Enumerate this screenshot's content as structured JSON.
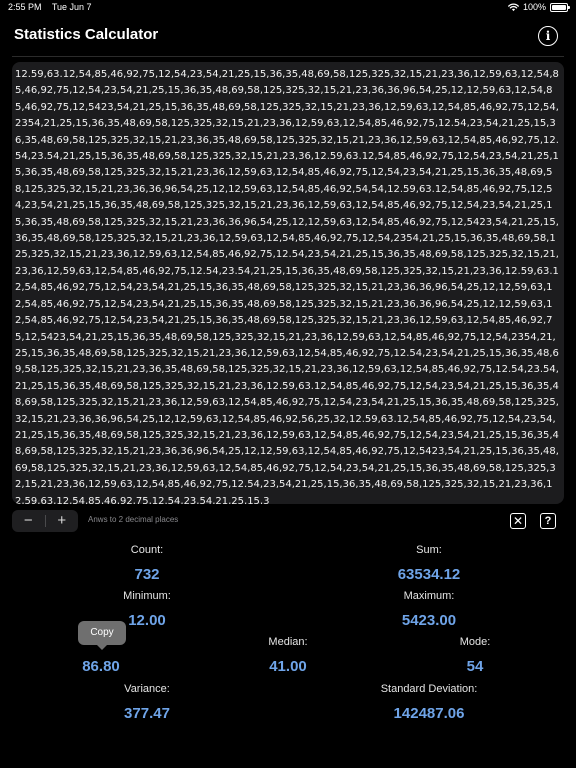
{
  "status_bar": {
    "time": "2:55 PM",
    "date": "Tue Jun 7",
    "battery": "100%",
    "battery_level": 1.0
  },
  "header": {
    "title": "Statistics Calculator",
    "info_icon": "info-circle-icon",
    "info_glyph": "i"
  },
  "input": {
    "text": "12.59,63.12,54,85,46,92,75,12,54,23,54,21,25,15,36,35,48,69,58,125,325,32,15,21,23,36,12,59,63,12,54,85,46,92,75,12,54,23,54,21,25,15,36,35,48,69,58,125,325,32,15,21,23,36,36,96,54,25,12,12,59,63,12,54,85,46,92,75,12,5423,54,21,25,15,36,35,48,69,58,125,325,32,15,21,23,36,12,59,63,12,54,85,46,92,75,12,54,2354,21,25,15,36,35,48,69,58,125,325,32,15,21,23,36,12,59,63,12,54,85,46,92,75,12.54,23,54,21,25,15,36,35,48,69,58,125,325,32,15,21,23,36,35,48,69,58,125,325,32,15,21,23,36,12,59,63,12,54,85,46,92,75,12.54,23.54,21,25,15,36,35,48,69,58,125,325,32,15,21,23,36,12.59,63.12,54,85,46,92,75,12,54,23,54,21,25,15,36,35,48,69,58,125,325,32,15,21,23,36,12,59,63,12,54,85,46,92,75,12,54,23,54,21,25,15,36,35,48,69,58,125,325,32,15,21,23,36,36,96,54,25,12,12,59,63,12,54,85,46,92,54,54,12.59,63.12,54,85,46,92,75,12,54,23,54,21,25,15,36,35,48,69,58,125,325,32,15,21,23,36,12,59,63,12,54,85,46,92,75,12,54,23,54,21,25,15,36,35,48,69,58,125,325,32,15,21,23,36,36,96,54,25,12,12,59,63,12,54,85,46,92,75,12,5423,54,21,25,15,36,35,48,69,58,125,325,32,15,21,23,36,12,59,63,12,54,85,46,92,75,12,54,2354,21,25,15,36,35,48,69,58,125,325,32,15,21,23,36,12,59,63,12,54,85,46,92,75,12.54,23,54,21,25,15,36,35,48,69,58,125,325,32,15,21,23,36,12,59,63,12,54,85,46,92,75,12.54,23.54,21,25,15,36,35,48,69,58,125,325,32,15,21,23,36,12.59,63.12,54,85,46,92,75,12,54,23,54,21,25,15,36,35,48,69,58,125,325,32,15,21,23,36,36,96,54,25,12,12,59,63,12,54,85,46,92,75,12,54,23,54,21,25,15,36,35,48,69,58,125,325,32,15,21,23,36,36,96,54,25,12,12,59,63,12,54,85,46,92,75,12,54,23,54,21,25,15,36,35,48,69,58,125,325,32,15,21,23,36,12,59,63,12,54,85,46,92,75,12,5423,54,21,25,15,36,35,48,69,58,125,325,32,15,21,23,36,12,59,63,12,54,85,46,92,75,12,54,2354,21,25,15,36,35,48,69,58,125,325,32,15,21,23,36,12,59,63,12,54,85,46,92,75,12.54,23,54,21,25,15,36,35,48,69,58,125,325,32,15,21,23,36,35,48,69,58,125,325,32,15,21,23,36,12,59,63,12,54,85,46,92,75,12.54,23.54,21,25,15,36,35,48,69,58,125,325,32,15,21,23,36,12.59,63.12,54,85,46,92,75,12,54,23,54,21,25,15,36,35,48,69,58,125,325,32,15,21,23,36,12,59,63,12,54,85,46,92,75,12,54,23,54,21,25,15,36,35,48,69,58,125,325,32,15,21,23,36,36,96,54,25,12,12,59,63,12,54,85,46,92,56,25,32,12.59,63.12,54,85,46,92,75,12,54,23,54,21,25,15,36,35,48,69,58,125,325,32,15,21,23,36,12,59,63,12,54,85,46,92,75,12,54,23,54,21,25,15,36,35,48,69,58,125,325,32,15,21,23,36,36,96,54,25,12,12,59,63,12,54,85,46,92,75,12,5423,54,21,25,15,36,35,48,69,58,125,325,32,15,21,23,36,12,59,63,12,54,85,46,92,75,12,54,23,54,21,25,15,36,35,48,69,58,125,325,32,15,21,23,36,12,59,63,12,54,85,46,92,75,12.54,23,54,21,25,15,36,35,48,69,58,125,325,32,15,21,23,36,12,59,63,12,54,85,46,92,75,12.54,23,54,21,25,15,3"
  },
  "toolbar": {
    "decrement": "−",
    "increment": "+",
    "precision_label": "Anws to 2 decimal places",
    "clear_icon": "clear-xmark-icon",
    "clear_glyph": "✕",
    "help_icon": "question-mark-icon",
    "help_glyph": "?"
  },
  "stats": {
    "count": {
      "label": "Count:",
      "value": "732"
    },
    "sum": {
      "label": "Sum:",
      "value": "63534.12"
    },
    "minimum": {
      "label": "Minimum:",
      "value": "12.00"
    },
    "maximum": {
      "label": "Maximum:",
      "value": "5423.00"
    },
    "mean": {
      "label": "",
      "value": "86.80"
    },
    "median": {
      "label": "Median:",
      "value": "41.00"
    },
    "mode": {
      "label": "Mode:",
      "value": "54"
    },
    "variance": {
      "label": "Variance:",
      "value": "377.47"
    },
    "std_dev": {
      "label": "Standard Deviation:",
      "value": "142487.06"
    }
  },
  "tooltip": {
    "label": "Copy"
  },
  "colors": {
    "accent": "#6fa4e8",
    "text_bg": "#1c1c1e",
    "background": "#000000",
    "tooltip_bg": "#6f6f6f"
  }
}
